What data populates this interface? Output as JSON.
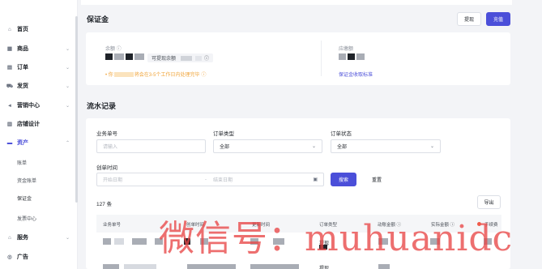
{
  "sidebar": {
    "items": [
      {
        "label": "首页",
        "icon": "home-icon"
      },
      {
        "label": "商品",
        "icon": "goods-icon"
      },
      {
        "label": "订单",
        "icon": "order-icon"
      },
      {
        "label": "发货",
        "icon": "truck-icon"
      },
      {
        "label": "营销中心",
        "icon": "megaphone-icon"
      },
      {
        "label": "店铺设计",
        "icon": "store-icon"
      },
      {
        "label": "资产",
        "icon": "wallet-icon"
      },
      {
        "label": "服务",
        "icon": "service-icon"
      },
      {
        "label": "广告",
        "icon": "ad-icon"
      }
    ],
    "asset_sub": [
      "账单",
      "资金账单",
      "保证金",
      "发票中心"
    ]
  },
  "deposit": {
    "title": "保证金",
    "withdraw_label": "提现",
    "recharge_label": "充值",
    "balance_label": "余额",
    "withdrawable_label": "可提现余额",
    "notice_prefix": "• 你",
    "notice_suffix": "将会在3-5个工作日内处理完毕",
    "due_label": "应缴额",
    "fee_standard_link": "保证金收取标准"
  },
  "flow": {
    "title": "流水记录",
    "order_no_label": "业务单号",
    "order_no_placeholder": "请输入",
    "order_type_label": "订单类型",
    "order_type_value": "全部",
    "order_status_label": "订单状态",
    "order_status_value": "全部",
    "created_label": "创单时间",
    "start_placeholder": "开始日期",
    "end_placeholder": "结束日期",
    "search_label": "搜索",
    "reset_label": "重置",
    "count": "127 条",
    "export_label": "导出",
    "columns": [
      "业务单号",
      "创单时间",
      "更新时间",
      "订单类型",
      "动账金额",
      "实际金额",
      "手续费"
    ],
    "row_types": [
      "提现",
      "提现"
    ]
  },
  "watermark": "微信号：muhuanidc",
  "colors": {
    "accent": "#4b4fd9",
    "warning": "#f0a43a",
    "danger": "#f05b4a"
  }
}
